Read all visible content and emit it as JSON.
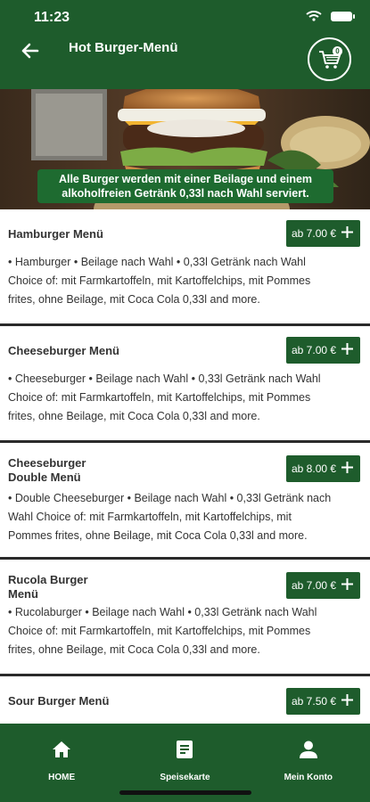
{
  "status": {
    "time": "11:23"
  },
  "header": {
    "title": "Hot Burger-Menü",
    "cart_count": "0"
  },
  "hero": {
    "banner_line1": "Alle Burger werden mit einer Beilage und einem",
    "banner_line2": "alkoholfreien Getränk 0,33l nach Wahl serviert."
  },
  "items": [
    {
      "name": "Hamburger Menü",
      "price": "ab 7.00 €",
      "desc_line1": "• Hamburger • Beilage nach Wahl • 0,33l Getränk nach Wahl",
      "desc_line2": "Choice of: mit Farmkartoffeln, mit Kartoffelchips, mit Pommes",
      "desc_line3": "frites, ohne Beilage, mit Coca Cola 0,33l and more."
    },
    {
      "name": "Cheeseburger Menü",
      "price": "ab 7.00 €",
      "desc_line1": "• Cheeseburger • Beilage nach Wahl • 0,33l Getränk nach Wahl",
      "desc_line2": "Choice of: mit Farmkartoffeln, mit Kartoffelchips, mit Pommes",
      "desc_line3": "frites, ohne Beilage, mit Coca Cola 0,33l and more."
    },
    {
      "name_line1": "Cheeseburger",
      "name_line2": "Double Menü",
      "price": "ab 8.00 €",
      "desc_line1": "• Double Cheeseburger • Beilage nach Wahl • 0,33l Getränk nach",
      "desc_line2": "Wahl Choice of: mit Farmkartoffeln, mit Kartoffelchips, mit",
      "desc_line3": "Pommes frites, ohne Beilage, mit Coca Cola 0,33l and more."
    },
    {
      "name_line1": "Rucola Burger",
      "name_line2": "Menü",
      "price": "ab 7.00 €",
      "desc_line1": "• Rucolaburger • Beilage nach Wahl • 0,33l Getränk nach Wahl",
      "desc_line2": "Choice of: mit Farmkartoffeln, mit Kartoffelchips, mit Pommes",
      "desc_line3": "frites, ohne Beilage, mit Coca Cola 0,33l and more."
    },
    {
      "name": "Sour Burger Menü",
      "price": "ab 7.50 €"
    }
  ],
  "nav": {
    "home": "HOME",
    "menu": "Speisekarte",
    "account": "Mein Konto"
  },
  "colors": {
    "primary": "#1e5c2c",
    "banner": "#1e6b30",
    "text": "#333333"
  },
  "icons": {
    "back": "arrow-left-icon",
    "cart": "shopping-cart-icon",
    "plus": "plus-icon",
    "home": "home-icon",
    "menu": "document-list-icon",
    "account": "person-icon"
  }
}
